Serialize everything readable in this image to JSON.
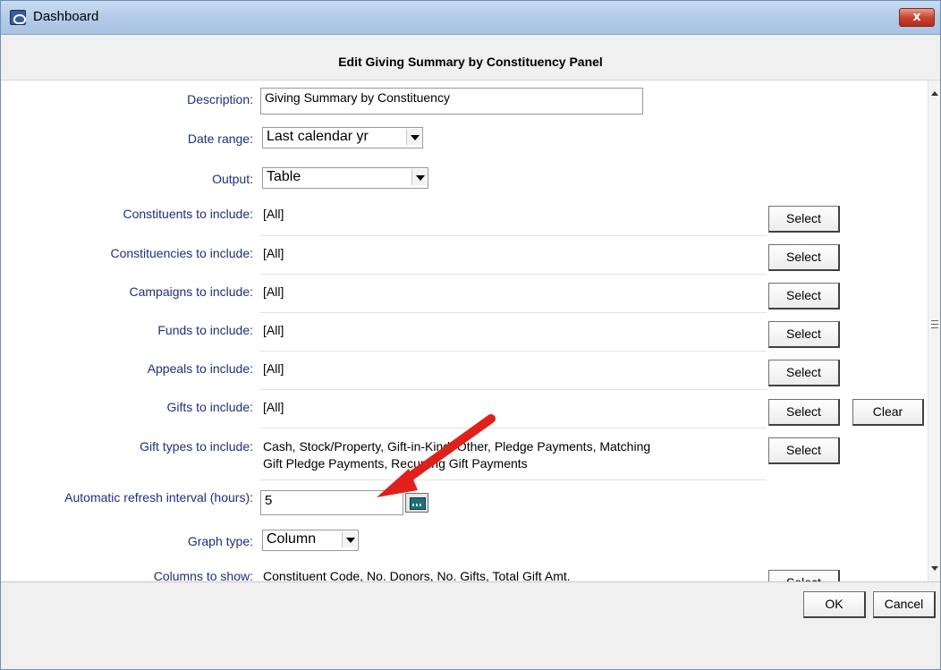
{
  "window": {
    "title": "Dashboard",
    "close_label": "x"
  },
  "panel": {
    "title": "Edit Giving Summary by Constituency Panel"
  },
  "form": {
    "description": {
      "label": "Description:",
      "value": "Giving Summary by Constituency"
    },
    "date_range": {
      "label": "Date range:",
      "value": "Last calendar yr"
    },
    "output": {
      "label": "Output:",
      "value": "Table"
    },
    "constituents": {
      "label": "Constituents to include:",
      "value": "[All]"
    },
    "constituencies": {
      "label": "Constituencies to include:",
      "value": "[All]"
    },
    "campaigns": {
      "label": "Campaigns to include:",
      "value": "[All]"
    },
    "funds": {
      "label": "Funds to include:",
      "value": "[All]"
    },
    "appeals": {
      "label": "Appeals to include:",
      "value": "[All]"
    },
    "gifts": {
      "label": "Gifts to include:",
      "value": "[All]"
    },
    "gift_types": {
      "label": "Gift types to include:",
      "line1": "Cash, Stock/Property, Gift-in-Kind, Other, Pledge Payments, Matching",
      "line2": "Gift Pledge Payments, Recurring Gift Payments"
    },
    "refresh": {
      "label": "Automatic refresh interval (hours):",
      "value": "5"
    },
    "graph_type": {
      "label": "Graph type:",
      "value": "Column"
    },
    "columns": {
      "label": "Columns to show:",
      "value": "Constituent Code, No. Donors, No. Gifts, Total Gift Amt."
    }
  },
  "buttons": {
    "select": "Select",
    "clear": "Clear",
    "ok": "OK",
    "cancel": "Cancel"
  },
  "colors": {
    "label": "#1f2f7a",
    "annotation_arrow": "#e0201a"
  },
  "icons": {
    "app": "dashboard-handshake-icon",
    "calculator": "calculator-icon",
    "annotation": "red-arrow-annotation"
  }
}
